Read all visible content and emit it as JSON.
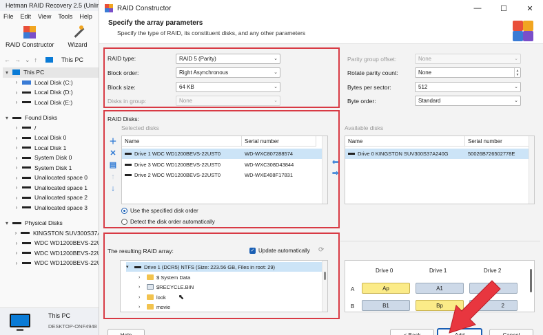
{
  "bg_app": {
    "title": "Hetman RAID Recovery 2.5 (Unlim",
    "menu": [
      "File",
      "Edit",
      "View",
      "Tools",
      "Help"
    ],
    "toolbar": {
      "raid_constructor": "RAID Constructor",
      "wizard": "Wizard"
    },
    "location": "This PC",
    "tree": {
      "this_pc": "This PC",
      "local_disks": [
        "Local Disk (C:)",
        "Local Disk (D:)",
        "Local Disk (E:)"
      ],
      "found_disks": "Found Disks",
      "found_items": [
        "/",
        "Local Disk 0",
        "Local Disk 1",
        "System Disk 0",
        "System Disk 1",
        "Unallocated space 0",
        "Unallocated space 1",
        "Unallocated space 2",
        "Unallocated space 3"
      ],
      "physical_disks": "Physical Disks",
      "physical_items": [
        "KINGSTON SUV300S37A",
        "WDC WD1200BEVS-22U",
        "WDC WD1200BEVS-22U",
        "WDC WD1200BEVS-22U"
      ]
    },
    "footer": {
      "pc_name": "This PC",
      "host": "DESKTOP-ONF4948"
    }
  },
  "dialog": {
    "title": "RAID Constructor",
    "controls": {
      "minimize": "—",
      "maximize": "☐",
      "close": "✕"
    },
    "header": {
      "title": "Specify the array parameters",
      "subtitle": "Specify the type of RAID, its constituent disks, and any other parameters"
    },
    "params": {
      "raid_type_label": "RAID type:",
      "raid_type_value": "RAID 5 (Parity)",
      "block_order_label": "Block order:",
      "block_order_value": "Right Asynchronous",
      "block_size_label": "Block size:",
      "block_size_value": "64 KB",
      "disks_in_group_label": "Disks in group:",
      "disks_in_group_value": "None",
      "parity_offset_label": "Parity group offset:",
      "parity_offset_value": "None",
      "rotate_parity_label": "Rotate parity count:",
      "rotate_parity_value": "None",
      "bytes_per_sector_label": "Bytes per sector:",
      "bytes_per_sector_value": "512",
      "byte_order_label": "Byte order:",
      "byte_order_value": "Standard"
    },
    "raid_disks": {
      "label": "RAID Disks:",
      "selected_label": "Selected disks",
      "available_label": "Available disks",
      "columns": [
        "Name",
        "Serial number"
      ],
      "selected": [
        {
          "name": "Drive 1 WDC WD1200BEVS-22UST0",
          "serial": "WD-WXC807288574"
        },
        {
          "name": "Drive 3 WDC WD1200BEVS-22UST0",
          "serial": "WD-WXC308D43844"
        },
        {
          "name": "Drive 2 WDC WD1200BEVS-22UST0",
          "serial": "WD-WXE408F17831"
        }
      ],
      "available": [
        {
          "name": "Drive 0 KINGSTON SUV300S37A240G",
          "serial": "50026B726502778E"
        }
      ],
      "order_specified": "Use the specified disk order",
      "order_auto": "Detect the disk order automatically"
    },
    "result": {
      "label": "The resulting RAID array:",
      "update_auto": "Update automatically",
      "root": "Drive 1 (DCR5) NTFS (Size: 223.56 GB, Files in root: 29)",
      "items": [
        "$ System Data",
        "$RECYCLE.BIN",
        "look",
        "movie"
      ]
    },
    "grid": {
      "headers": [
        "Drive 0",
        "Drive 1",
        "Drive 2"
      ],
      "rows": [
        {
          "label": "A",
          "cells": [
            "Ap",
            "A1",
            ""
          ]
        },
        {
          "label": "B",
          "cells": [
            "B1",
            "Bp",
            "2"
          ]
        }
      ]
    },
    "buttons": {
      "help": "Help",
      "back": "< Back",
      "add": "Add",
      "cancel": "Cancel"
    }
  },
  "colors": {
    "highlight_red": "#d83a44",
    "annotation_arrow": "#e8363f",
    "selection": "#cce4f7",
    "accent": "#2b78d4"
  }
}
